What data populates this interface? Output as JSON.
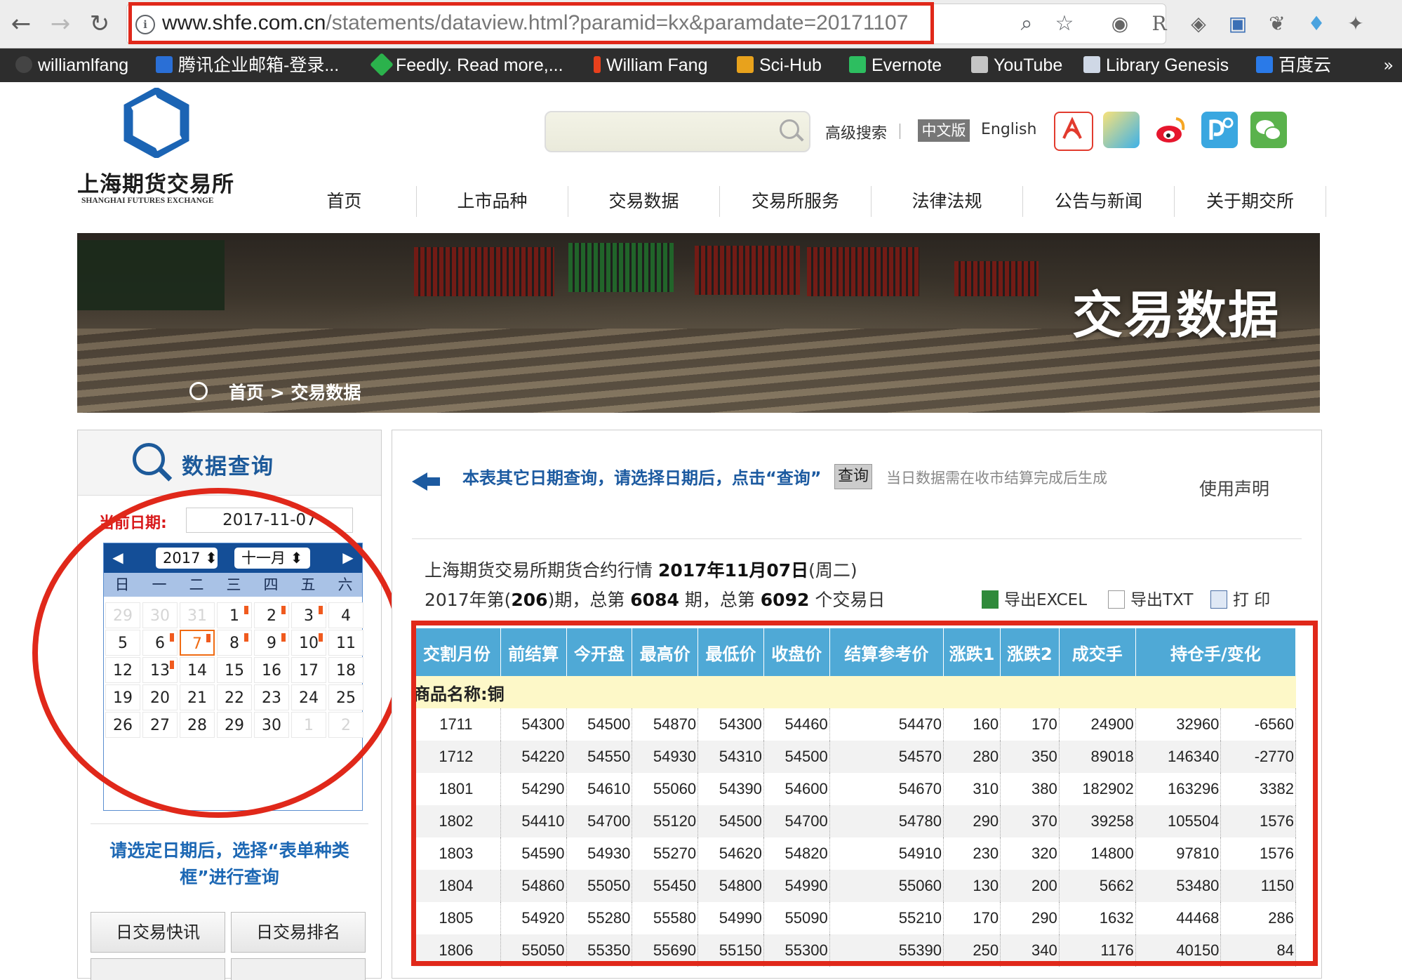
{
  "browser": {
    "url_host": "www.shfe.com.cn",
    "url_path": "/statements/dataview.html?paramid=kx&paramdate=20171107",
    "bookmarks": [
      {
        "label": "williamlfang",
        "icon_color": "#444"
      },
      {
        "label": "腾讯企业邮箱-登录...",
        "icon_color": "#2a6fd6"
      },
      {
        "label": "Feedly. Read more,...",
        "icon_color": "#2bb24c"
      },
      {
        "label": "William Fang",
        "icon_color": "#e8401c"
      },
      {
        "label": "Sci-Hub",
        "icon_color": "#e8a21c"
      },
      {
        "label": "Evernote",
        "icon_color": "#2dbe60"
      },
      {
        "label": "YouTube",
        "icon_color": "#c4c4c4"
      },
      {
        "label": "Library Genesis",
        "icon_color": "#cfd8e6"
      },
      {
        "label": "百度云",
        "icon_color": "#2a7ae8"
      }
    ],
    "more": "»"
  },
  "site": {
    "logo_cn": "上海期货交易所",
    "logo_en": "SHANGHAI FUTURES EXCHANGE",
    "advanced_search": "高级搜索",
    "lang_cn": "中文版",
    "lang_en": "English",
    "nav": [
      "首页",
      "上市品种",
      "交易数据",
      "交易所服务",
      "法律法规",
      "公告与新闻",
      "关于期交所"
    ],
    "banner_title": "交易数据",
    "breadcrumb": "首页 > 交易数据",
    "social_icons": [
      "pdf-icon",
      "kuaidi-icon",
      "weibo-icon",
      "app-icon",
      "wechat-icon"
    ]
  },
  "left": {
    "title": "数据查询",
    "current_date_label": "当前日期:",
    "current_date": "2017-11-07",
    "calendar": {
      "year": "2017",
      "month": "十一月",
      "weekdays": [
        "日",
        "一",
        "二",
        "三",
        "四",
        "五",
        "六"
      ],
      "weeks": [
        [
          {
            "d": "29",
            "o": true
          },
          {
            "d": "30",
            "o": true
          },
          {
            "d": "31",
            "o": true
          },
          {
            "d": "1",
            "f": true
          },
          {
            "d": "2",
            "f": true
          },
          {
            "d": "3",
            "f": true
          },
          {
            "d": "4"
          }
        ],
        [
          {
            "d": "5"
          },
          {
            "d": "6",
            "f": true
          },
          {
            "d": "7",
            "f": true,
            "t": true
          },
          {
            "d": "8",
            "f": true
          },
          {
            "d": "9",
            "f": true
          },
          {
            "d": "10",
            "f": true
          },
          {
            "d": "11"
          }
        ],
        [
          {
            "d": "12"
          },
          {
            "d": "13",
            "f": true
          },
          {
            "d": "14"
          },
          {
            "d": "15"
          },
          {
            "d": "16"
          },
          {
            "d": "17"
          },
          {
            "d": "18"
          }
        ],
        [
          {
            "d": "19"
          },
          {
            "d": "20"
          },
          {
            "d": "21"
          },
          {
            "d": "22"
          },
          {
            "d": "23"
          },
          {
            "d": "24"
          },
          {
            "d": "25"
          }
        ],
        [
          {
            "d": "26"
          },
          {
            "d": "27"
          },
          {
            "d": "28"
          },
          {
            "d": "29"
          },
          {
            "d": "30"
          },
          {
            "d": "1",
            "o": true
          },
          {
            "d": "2",
            "o": true
          }
        ]
      ]
    },
    "hint": "请选定日期后，选择“表单种类框”进行查询",
    "buttons": [
      "日交易快讯",
      "日交易排名"
    ]
  },
  "right": {
    "notice": "本表其它日期查询，请选择日期后，点击“查询”",
    "query_button": "查询",
    "notice2": "当日数据需在收市结算完成后生成",
    "disclaimer": "使用声明",
    "info_line1_prefix": "上海期货交易所期货合约行情 ",
    "info_line1_date": "2017年11月07日",
    "info_line1_suffix": "(周二)",
    "info_line2": {
      "p1": "2017年第(",
      "n1": "206",
      "p2": ")期，总第 ",
      "n2": "6084",
      "p3": " 期，总第 ",
      "n3": "6092",
      "p4": " 个交易日"
    },
    "exports": [
      "导出EXCEL",
      "导出TXT",
      "打 印"
    ],
    "table": {
      "headers": [
        "交割月份",
        "前结算",
        "今开盘",
        "最高价",
        "最低价",
        "收盘价",
        "结算参考价",
        "涨跌1",
        "涨跌2",
        "成交手",
        "持仓手/变化"
      ],
      "product_label": "商品名称:铜",
      "rows": [
        [
          "1711",
          "54300",
          "54500",
          "54870",
          "54300",
          "54460",
          "54470",
          "160",
          "170",
          "24900",
          "32960",
          "-6560"
        ],
        [
          "1712",
          "54220",
          "54550",
          "54930",
          "54310",
          "54500",
          "54570",
          "280",
          "350",
          "89018",
          "146340",
          "-2770"
        ],
        [
          "1801",
          "54290",
          "54610",
          "55060",
          "54390",
          "54600",
          "54670",
          "310",
          "380",
          "182902",
          "163296",
          "3382"
        ],
        [
          "1802",
          "54410",
          "54700",
          "55120",
          "54500",
          "54700",
          "54780",
          "290",
          "370",
          "39258",
          "105504",
          "1576"
        ],
        [
          "1803",
          "54590",
          "54930",
          "55270",
          "54620",
          "54820",
          "54910",
          "230",
          "320",
          "14800",
          "97810",
          "1576"
        ],
        [
          "1804",
          "54860",
          "55050",
          "55450",
          "54800",
          "54990",
          "55060",
          "130",
          "200",
          "5662",
          "53480",
          "1150"
        ],
        [
          "1805",
          "54920",
          "55280",
          "55580",
          "54990",
          "55090",
          "55210",
          "170",
          "290",
          "1632",
          "44468",
          "286"
        ],
        [
          "1806",
          "55050",
          "55350",
          "55690",
          "55150",
          "55300",
          "55390",
          "250",
          "340",
          "1176",
          "40150",
          "84"
        ]
      ]
    }
  }
}
